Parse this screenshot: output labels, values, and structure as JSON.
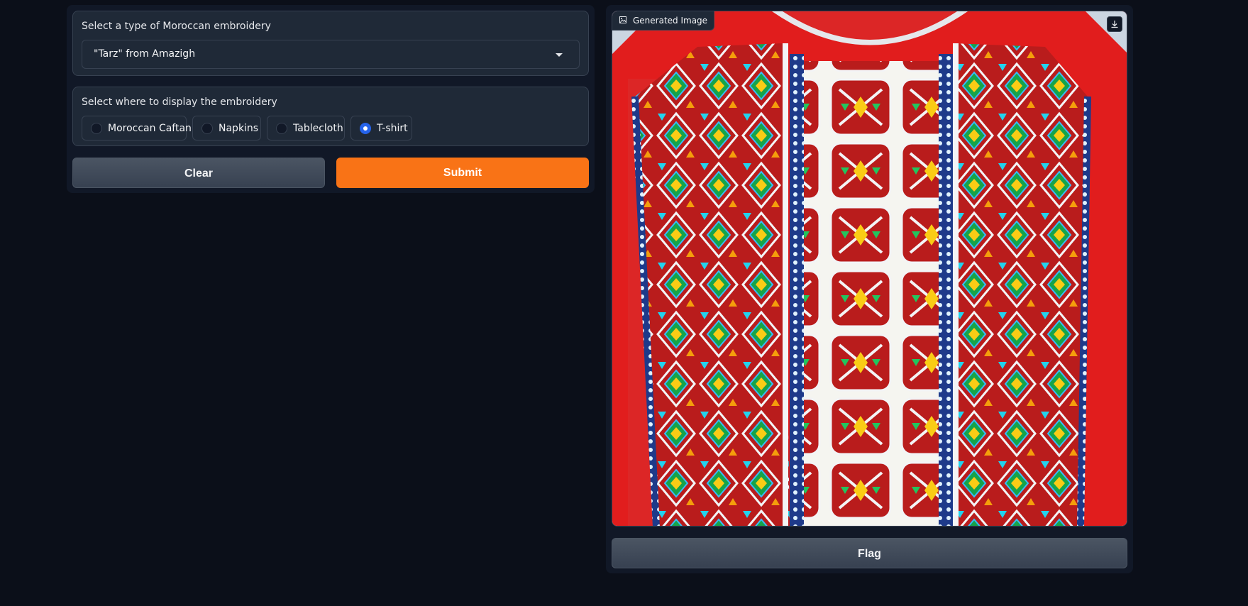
{
  "inputs": {
    "embroidery_type": {
      "label": "Select a type of Moroccan embroidery",
      "selected": "\"Tarz\" from Amazigh"
    },
    "display_location": {
      "label": "Select where to display the embroidery",
      "options": [
        "Moroccan Caftan",
        "Napkins",
        "Tablecloth",
        "T-shirt"
      ],
      "selected": "T-shirt"
    }
  },
  "buttons": {
    "clear": "Clear",
    "submit": "Submit",
    "flag": "Flag"
  },
  "output": {
    "label": "Generated Image",
    "image_icon": "image-icon",
    "download_icon": "download-icon"
  },
  "colors": {
    "accent": "#f97316",
    "radio_checked": "#2563eb",
    "shirt_red": "#e11d1d"
  }
}
